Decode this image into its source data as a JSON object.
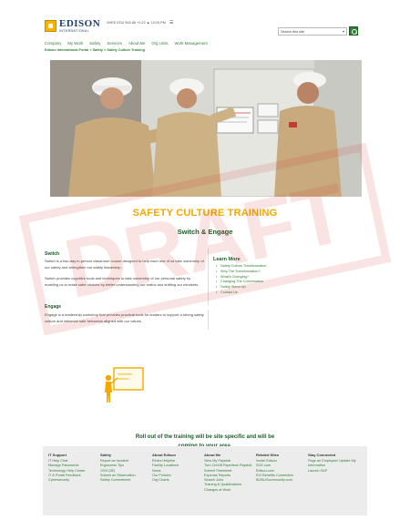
{
  "header": {
    "logo_name": "EDISON",
    "logo_sub": "INTERNATIONAL",
    "stamp": "NVEE EDU $42.88 +0.22 ▲ 10:20 PM",
    "menu_glyph": "☰",
    "search_placeholder": "Search this site",
    "search_arrow": "▾"
  },
  "nav": [
    "Company",
    "My Work",
    "Safety",
    "Services",
    "About Me",
    "Org Units",
    "Work Management"
  ],
  "breadcrumb": {
    "parts": [
      "Edison International Portal",
      "Safety",
      "Safety Culture Training"
    ],
    "sep": " > "
  },
  "page": {
    "title": "SAFETY CULTURE TRAINING",
    "subtitle": "Switch & Engage"
  },
  "switch_section": {
    "heading": "Switch",
    "p1": "Switch is a two-day in-person classroom course designed to help each one of us take ownership of our safety and strengthen our safety leadership.",
    "p2": "Switch provides cognitive tools and techniques to take ownership of our personal safety by enabling us to make safer choices by better understanding our brains and shifting our mindsets."
  },
  "engage_section": {
    "heading": "Engage",
    "p1": "Engage is a leadership workshop that provides practical tools for leaders to support a strong safety culture and influence safe behaviors aligned with our values."
  },
  "learn_more": {
    "heading": "Learn More",
    "items": [
      "Safety Culture Transformation",
      "Why The Transformation?",
      "What's Changing?",
      "Changing The Conversation",
      "Safety Stand Up",
      "Contact Us"
    ]
  },
  "rollout": {
    "line1": "Roll out of the training will be site specific and will be",
    "line2": "coming to your area."
  },
  "footer": {
    "columns": [
      {
        "heading": "IT Support",
        "items": [
          "IT Help Chat",
          "Manage Passwords",
          "Technology Help Center",
          "IT & Portal Feedback",
          "Cybersecurity"
        ]
      },
      {
        "heading": "Safety",
        "items": [
          "Report an Incident",
          "Ergonomic Tips",
          "OSS (3E)",
          "Submit an Observation",
          "Safety Commitment"
        ]
      },
      {
        "heading": "About Edison",
        "items": [
          "Ethics Helpline",
          "Facility Locations",
          "News",
          "Our Policies",
          "Org Charts"
        ]
      },
      {
        "heading": "About Me",
        "items": [
          "View My Paystub",
          "Turn On/Off Paperless Paystub",
          "Submit Timesheet",
          "Expense Reports",
          "Search Jobs",
          "Training & Qualifications",
          "Changes at Work"
        ]
      },
      {
        "heading": "Related Sites",
        "items": [
          "Inside Edison",
          "SCE.com",
          "Edison.com",
          "EIX Benefits Connection",
          "BONUScommunity.com"
        ]
      },
      {
        "heading": "Stay Connected",
        "items": [
          "Page an Employee/ Update My Information",
          "Launch SAP"
        ]
      }
    ]
  },
  "watermark_text": "DRAFT",
  "colors": {
    "brand_green": "#1e5a2a",
    "link_green": "#2e7d32",
    "title_gold": "#f2a900",
    "footer_bg": "#ececec"
  }
}
